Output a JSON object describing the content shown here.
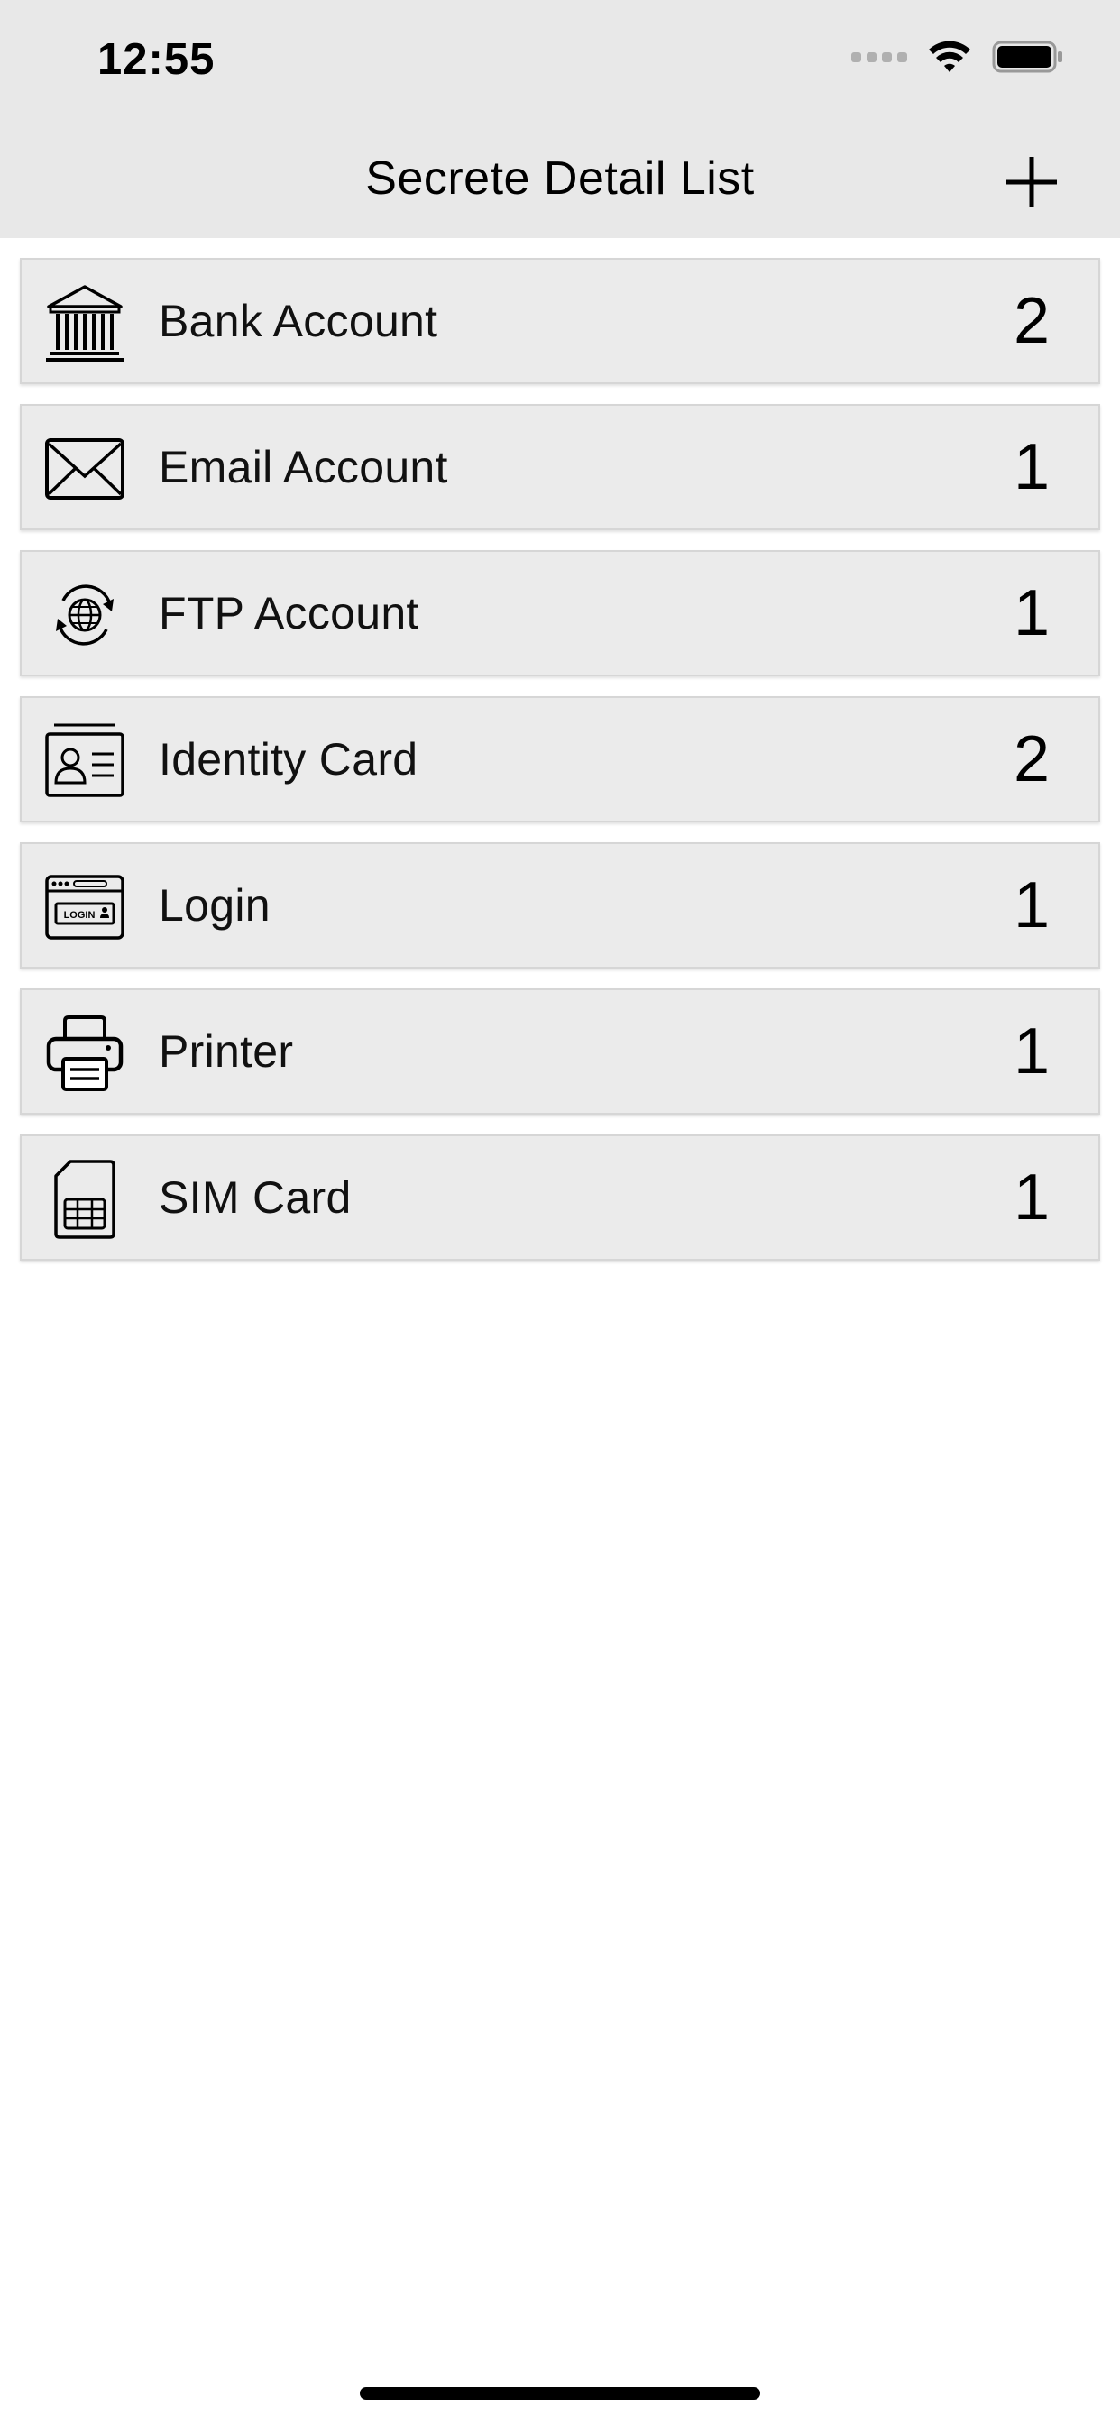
{
  "status_bar": {
    "time": "12:55"
  },
  "nav": {
    "title": "Secrete Detail List",
    "add_icon": "plus-icon"
  },
  "list": {
    "items": [
      {
        "label": "Bank Account",
        "count": "2",
        "icon": "bank-icon"
      },
      {
        "label": "Email Account",
        "count": "1",
        "icon": "envelope-icon"
      },
      {
        "label": "FTP Account",
        "count": "1",
        "icon": "globe-sync-icon"
      },
      {
        "label": "Identity Card",
        "count": "2",
        "icon": "id-card-icon"
      },
      {
        "label": "Login",
        "count": "1",
        "icon": "login-window-icon",
        "icon_text": "LOGIN"
      },
      {
        "label": "Printer",
        "count": "1",
        "icon": "printer-icon"
      },
      {
        "label": "SIM Card",
        "count": "1",
        "icon": "sim-card-icon"
      }
    ]
  },
  "colors": {
    "header_background": "#e8e8e8",
    "row_background": "#ebebeb",
    "page_background": "#ffffff",
    "text": "#111111"
  }
}
